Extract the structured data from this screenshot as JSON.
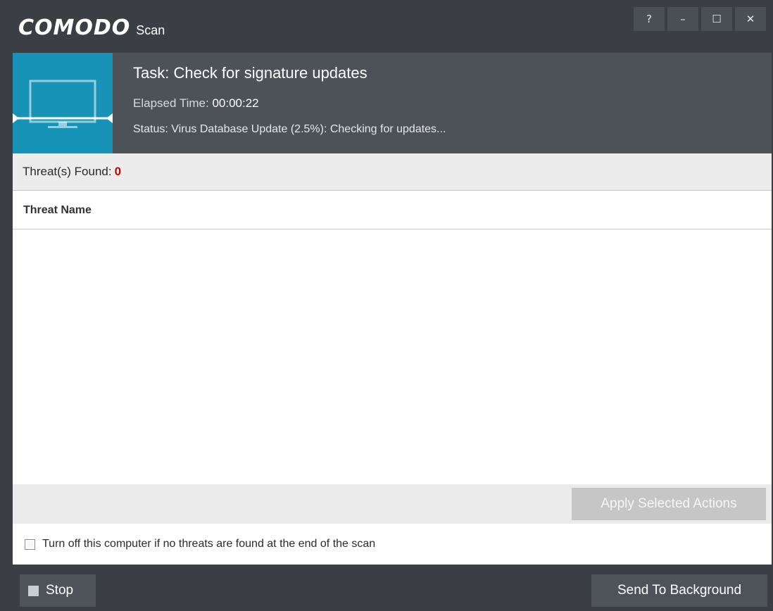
{
  "app": {
    "brand": "COMODO",
    "window_title": "Scan"
  },
  "window_controls": {
    "help": "?",
    "minimize": "–",
    "maximize": "☐",
    "close": "✕"
  },
  "header": {
    "task": "Task: Check for signature updates",
    "elapsed_label": "Elapsed Time: ",
    "elapsed_value": "00:00:22",
    "status": "Status: Virus Database Update (2.5%): Checking for updates...",
    "icon": "monitor-icon",
    "progress_fraction": 0.025
  },
  "threats": {
    "label": "Threat(s) Found: ",
    "count": "0"
  },
  "table": {
    "columns": [
      "Threat Name"
    ],
    "rows": []
  },
  "actions": {
    "apply_label": "Apply Selected Actions"
  },
  "options": {
    "shutdown_label": "Turn off this computer if no threats are found at the end of the scan",
    "shutdown_checked": false
  },
  "footer": {
    "stop_label": "Stop",
    "background_label": "Send To Background"
  },
  "colors": {
    "accent": "#1793b8",
    "chrome": "#3b3f45",
    "threat_count": "#d10000"
  }
}
